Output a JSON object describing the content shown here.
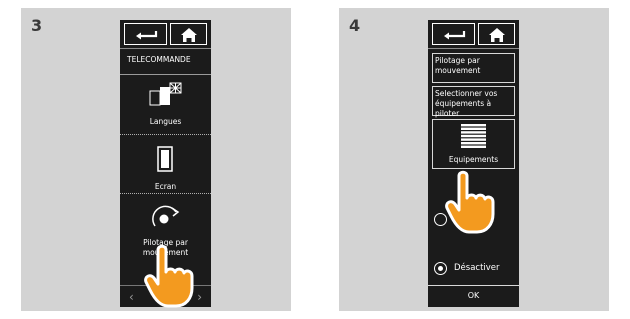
{
  "steps": [
    {
      "number": "3",
      "header": "TELECOMMANDE",
      "items": [
        {
          "label": "Langues",
          "icon": "flag-icon"
        },
        {
          "label": "Ecran",
          "icon": "screen-icon"
        },
        {
          "label": "Pilotage par mouvement",
          "icon": "rotate-icon"
        }
      ],
      "nav": {
        "prev": "‹",
        "next": "›"
      }
    },
    {
      "number": "4",
      "header": "Pilotage par mouvement",
      "subheader": "Selectionner vos équipements à piloter",
      "equipment_label": "Equipements",
      "radio_options": [
        {
          "label": "",
          "selected": false
        },
        {
          "label": "Désactiver",
          "selected": true
        }
      ],
      "ok_label": "OK"
    }
  ],
  "colors": {
    "panel_bg": "#d3d3d3",
    "device_bg": "#1b1b1b",
    "hand_orange": "#f39a1f"
  }
}
